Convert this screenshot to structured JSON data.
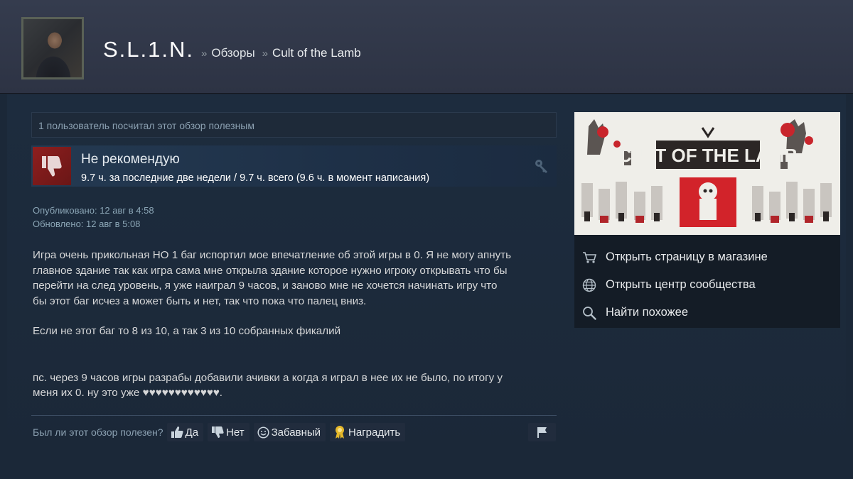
{
  "header": {
    "username": "S.L.1.N.",
    "separator": "»",
    "breadcrumbs": [
      "Обзоры",
      "Cult of the Lamb"
    ]
  },
  "review": {
    "helpful_count_text": "1 пользователь посчитал этот обзор полезным",
    "verdict": "Не рекомендую",
    "hours": "9.7 ч. за последние две недели / 9.7 ч. всего (9.6 ч. в момент написания)",
    "published": "Опубликовано: 12 авг в 4:58",
    "updated": "Обновлено: 12 авг в 5:08",
    "body": {
      "p1_lines": [
        "Игра очень прикольная НО 1 баг испортил мое впечатление об этой игры в 0. Я не могу апнуть",
        "главное здание так как игра сама мне открыла здание которое нужно игроку открывать что бы",
        "перейти на след уровень, я уже наиграл 9 часов, и заново мне не хочется начинать игру что",
        "бы этот баг исчез а может быть и нет, так что пока что палец вниз."
      ],
      "p2": "Если не этот баг то 8 из 10, а так 3 из 10 собранных фикалий",
      "p3_lines": [
        "пс. через 9 часов игры разрабы добавили ачивки а когда я играл в нее их не было, по итогу у",
        "меня их 0. ну это уже ♥♥♥♥♥♥♥♥♥♥♥♥."
      ]
    }
  },
  "vote": {
    "question": "Был ли этот обзор полезен?",
    "yes": "Да",
    "no": "Нет",
    "funny": "Забавный",
    "award": "Наградить"
  },
  "sidebar": {
    "game_logo_text": "CULT OF THE LAMB",
    "game_logo_small": "OF THE",
    "links": [
      {
        "label": "Открыть страницу в магазине",
        "icon": "cart-icon"
      },
      {
        "label": "Открыть центр сообщества",
        "icon": "globe-icon"
      },
      {
        "label": "Найти похожее",
        "icon": "magnifier-icon"
      }
    ]
  },
  "colors": {
    "background": "#1b2838",
    "header": "#353c4e",
    "thumb_down": "#8e1f1f",
    "link_text": "#e8eaec"
  }
}
